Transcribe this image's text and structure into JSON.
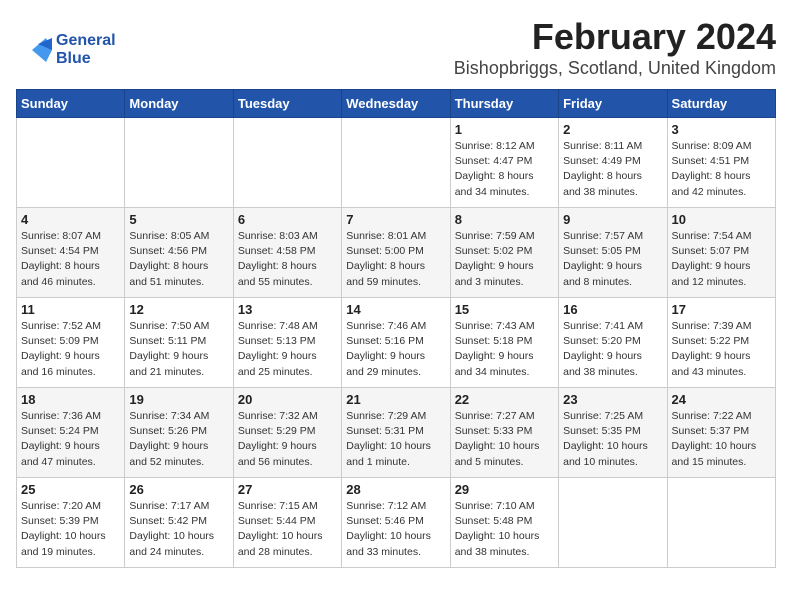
{
  "logo": {
    "line1": "General",
    "line2": "Blue"
  },
  "header": {
    "month": "February 2024",
    "location": "Bishopbriggs, Scotland, United Kingdom"
  },
  "weekdays": [
    "Sunday",
    "Monday",
    "Tuesday",
    "Wednesday",
    "Thursday",
    "Friday",
    "Saturday"
  ],
  "weeks": [
    [
      {
        "day": "",
        "content": ""
      },
      {
        "day": "",
        "content": ""
      },
      {
        "day": "",
        "content": ""
      },
      {
        "day": "",
        "content": ""
      },
      {
        "day": "1",
        "content": "Sunrise: 8:12 AM\nSunset: 4:47 PM\nDaylight: 8 hours\nand 34 minutes."
      },
      {
        "day": "2",
        "content": "Sunrise: 8:11 AM\nSunset: 4:49 PM\nDaylight: 8 hours\nand 38 minutes."
      },
      {
        "day": "3",
        "content": "Sunrise: 8:09 AM\nSunset: 4:51 PM\nDaylight: 8 hours\nand 42 minutes."
      }
    ],
    [
      {
        "day": "4",
        "content": "Sunrise: 8:07 AM\nSunset: 4:54 PM\nDaylight: 8 hours\nand 46 minutes."
      },
      {
        "day": "5",
        "content": "Sunrise: 8:05 AM\nSunset: 4:56 PM\nDaylight: 8 hours\nand 51 minutes."
      },
      {
        "day": "6",
        "content": "Sunrise: 8:03 AM\nSunset: 4:58 PM\nDaylight: 8 hours\nand 55 minutes."
      },
      {
        "day": "7",
        "content": "Sunrise: 8:01 AM\nSunset: 5:00 PM\nDaylight: 8 hours\nand 59 minutes."
      },
      {
        "day": "8",
        "content": "Sunrise: 7:59 AM\nSunset: 5:02 PM\nDaylight: 9 hours\nand 3 minutes."
      },
      {
        "day": "9",
        "content": "Sunrise: 7:57 AM\nSunset: 5:05 PM\nDaylight: 9 hours\nand 8 minutes."
      },
      {
        "day": "10",
        "content": "Sunrise: 7:54 AM\nSunset: 5:07 PM\nDaylight: 9 hours\nand 12 minutes."
      }
    ],
    [
      {
        "day": "11",
        "content": "Sunrise: 7:52 AM\nSunset: 5:09 PM\nDaylight: 9 hours\nand 16 minutes."
      },
      {
        "day": "12",
        "content": "Sunrise: 7:50 AM\nSunset: 5:11 PM\nDaylight: 9 hours\nand 21 minutes."
      },
      {
        "day": "13",
        "content": "Sunrise: 7:48 AM\nSunset: 5:13 PM\nDaylight: 9 hours\nand 25 minutes."
      },
      {
        "day": "14",
        "content": "Sunrise: 7:46 AM\nSunset: 5:16 PM\nDaylight: 9 hours\nand 29 minutes."
      },
      {
        "day": "15",
        "content": "Sunrise: 7:43 AM\nSunset: 5:18 PM\nDaylight: 9 hours\nand 34 minutes."
      },
      {
        "day": "16",
        "content": "Sunrise: 7:41 AM\nSunset: 5:20 PM\nDaylight: 9 hours\nand 38 minutes."
      },
      {
        "day": "17",
        "content": "Sunrise: 7:39 AM\nSunset: 5:22 PM\nDaylight: 9 hours\nand 43 minutes."
      }
    ],
    [
      {
        "day": "18",
        "content": "Sunrise: 7:36 AM\nSunset: 5:24 PM\nDaylight: 9 hours\nand 47 minutes."
      },
      {
        "day": "19",
        "content": "Sunrise: 7:34 AM\nSunset: 5:26 PM\nDaylight: 9 hours\nand 52 minutes."
      },
      {
        "day": "20",
        "content": "Sunrise: 7:32 AM\nSunset: 5:29 PM\nDaylight: 9 hours\nand 56 minutes."
      },
      {
        "day": "21",
        "content": "Sunrise: 7:29 AM\nSunset: 5:31 PM\nDaylight: 10 hours\nand 1 minute."
      },
      {
        "day": "22",
        "content": "Sunrise: 7:27 AM\nSunset: 5:33 PM\nDaylight: 10 hours\nand 5 minutes."
      },
      {
        "day": "23",
        "content": "Sunrise: 7:25 AM\nSunset: 5:35 PM\nDaylight: 10 hours\nand 10 minutes."
      },
      {
        "day": "24",
        "content": "Sunrise: 7:22 AM\nSunset: 5:37 PM\nDaylight: 10 hours\nand 15 minutes."
      }
    ],
    [
      {
        "day": "25",
        "content": "Sunrise: 7:20 AM\nSunset: 5:39 PM\nDaylight: 10 hours\nand 19 minutes."
      },
      {
        "day": "26",
        "content": "Sunrise: 7:17 AM\nSunset: 5:42 PM\nDaylight: 10 hours\nand 24 minutes."
      },
      {
        "day": "27",
        "content": "Sunrise: 7:15 AM\nSunset: 5:44 PM\nDaylight: 10 hours\nand 28 minutes."
      },
      {
        "day": "28",
        "content": "Sunrise: 7:12 AM\nSunset: 5:46 PM\nDaylight: 10 hours\nand 33 minutes."
      },
      {
        "day": "29",
        "content": "Sunrise: 7:10 AM\nSunset: 5:48 PM\nDaylight: 10 hours\nand 38 minutes."
      },
      {
        "day": "",
        "content": ""
      },
      {
        "day": "",
        "content": ""
      }
    ]
  ]
}
